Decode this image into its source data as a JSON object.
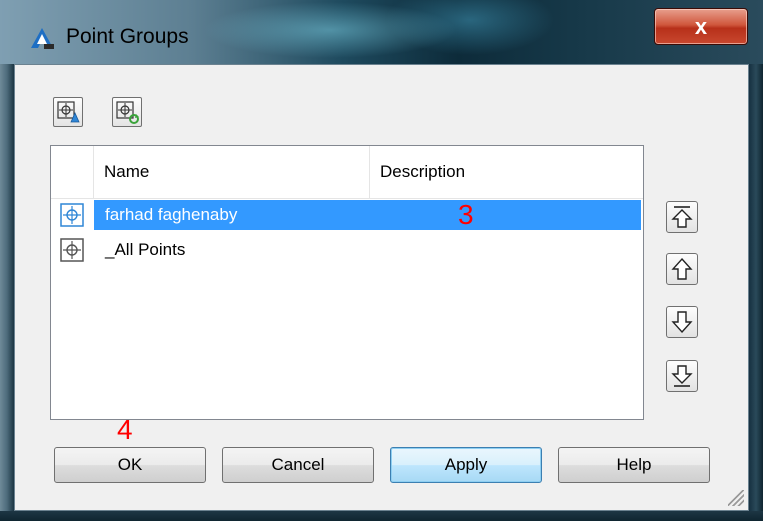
{
  "window": {
    "title": "Point Groups",
    "close_glyph": "x"
  },
  "toolbar": {
    "buttons": [
      {
        "icon": "point-group-properties-icon"
      },
      {
        "icon": "point-group-update-icon"
      }
    ]
  },
  "list": {
    "columns": [
      "Name",
      "Description"
    ],
    "rows": [
      {
        "name": "farhad faghenaby",
        "description": "",
        "selected": true,
        "icon": "point-group-icon"
      },
      {
        "name": "_All Points",
        "description": "",
        "selected": false,
        "icon": "point-group-icon"
      }
    ]
  },
  "side_buttons": [
    {
      "icon": "move-to-top-icon"
    },
    {
      "icon": "move-up-icon"
    },
    {
      "icon": "move-down-icon"
    },
    {
      "icon": "move-to-bottom-icon"
    }
  ],
  "buttons": {
    "ok": "OK",
    "cancel": "Cancel",
    "apply": "Apply",
    "help": "Help"
  },
  "annotations": {
    "a": "3",
    "b": "4"
  },
  "colors": {
    "selection": "#3399ff",
    "annotation": "#ff0000",
    "close_button": "#c9482f"
  }
}
